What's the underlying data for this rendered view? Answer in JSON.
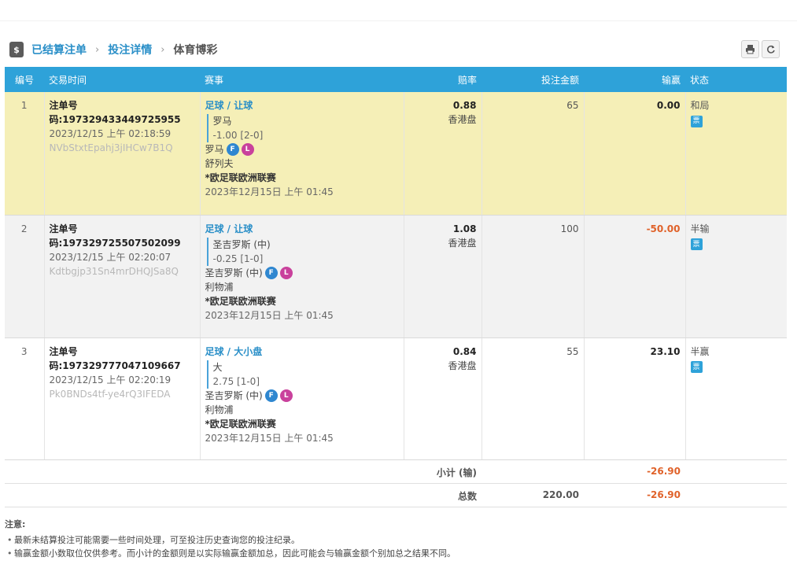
{
  "breadcrumb": {
    "icon": "dollar-icon",
    "items": [
      "已结算注单",
      "投注详情"
    ],
    "current": "体育博彩",
    "separator": "›"
  },
  "toolbar": {
    "print_icon": "print-icon",
    "refresh_icon": "refresh-icon"
  },
  "table": {
    "headers": {
      "index": "编号",
      "time": "交易时间",
      "event": "赛事",
      "odds": "赔率",
      "stake": "投注金额",
      "winloss": "输赢",
      "status": "状态"
    },
    "rows": [
      {
        "index": "1",
        "order": "注单号码:197329433449725955",
        "datetime": "2023/12/15 上午 02:18:59",
        "code": "NVbStxtEpahj3jIHCw7B1Q",
        "market": "足球 / 让球",
        "selection": "罗马",
        "handicap": "-1.00 [2-0]",
        "home": "罗马",
        "badge_f": "F",
        "badge_l": "L",
        "away": "舒列夫",
        "league": "*欧足联欧洲联赛",
        "match_time": "2023年12月15日 上午 01:45",
        "odds": "0.88",
        "odds_type": "香港盘",
        "stake": "65",
        "winloss": "0.00",
        "status": "和局"
      },
      {
        "index": "2",
        "order": "注单号码:197329725507502099",
        "datetime": "2023/12/15 上午 02:20:07",
        "code": "Kdtbgjp31Sn4mrDHQJSa8Q",
        "market": "足球 / 让球",
        "selection": "圣吉罗斯 (中)",
        "handicap": "-0.25 [1-0]",
        "home": "圣吉罗斯 (中)",
        "badge_f": "F",
        "badge_l": "L",
        "away": "利物浦",
        "league": "*欧足联欧洲联赛",
        "match_time": "2023年12月15日 上午 01:45",
        "odds": "1.08",
        "odds_type": "香港盘",
        "stake": "100",
        "winloss": "-50.00",
        "status": "半输"
      },
      {
        "index": "3",
        "order": "注单号码:197329777047109667",
        "datetime": "2023/12/15 上午 02:20:19",
        "code": "Pk0BNDs4tf-ye4rQ3IFEDA",
        "market": "足球 / 大小盘",
        "selection": "大",
        "handicap": "2.75 [1-0]",
        "home": "圣吉罗斯 (中)",
        "badge_f": "F",
        "badge_l": "L",
        "away": "利物浦",
        "league": "*欧足联欧洲联赛",
        "match_time": "2023年12月15日 上午 01:45",
        "odds": "0.84",
        "odds_type": "香港盘",
        "stake": "55",
        "winloss": "23.10",
        "status": "半赢"
      }
    ]
  },
  "summary": {
    "subtotal_label": "小计 (输)",
    "subtotal_winloss": "-26.90",
    "total_label": "总数",
    "total_stake": "220.00",
    "total_winloss": "-26.90"
  },
  "notes": {
    "title": "注意:",
    "items": [
      "最新未结算投注可能需要一些时间处理，可至投注历史查询您的投注纪录。",
      "输赢金额小数取位仅供参考。而小计的金额则是以实际输赢金额加总，因此可能会与输赢金额个别加总之结果不同。"
    ]
  },
  "colors": {
    "accent": "#2ea2d9",
    "link": "#2a8fc8",
    "negative": "#e0622a",
    "highlight_row": "#f5efb7"
  }
}
